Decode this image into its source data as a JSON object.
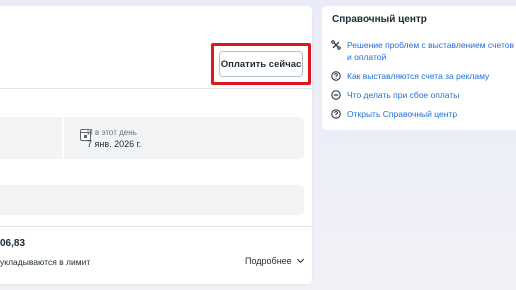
{
  "main": {
    "pay_button_label": "Оплатить сейчас",
    "info": {
      "label": "И в этот день",
      "value": "7 янв. 2026 г."
    },
    "amount": "06,83",
    "limit_text": "укладываются в лимит",
    "more_label": "Подробнее"
  },
  "help_center": {
    "title": "Справочный центр",
    "items": [
      {
        "label": "Решение проблем с выставлением счетов и оплатой",
        "icon": "troubleshoot-icon"
      },
      {
        "label": "Как выставляются счета за рекламу",
        "icon": "question-icon"
      },
      {
        "label": "Что делать при сбое оплаты",
        "icon": "minus-circle-icon"
      },
      {
        "label": "Открыть Справочный центр",
        "icon": "help-circle-icon"
      }
    ]
  },
  "colors": {
    "link": "#216fdb",
    "highlight": "#e0171f",
    "text": "#1c2b33"
  }
}
